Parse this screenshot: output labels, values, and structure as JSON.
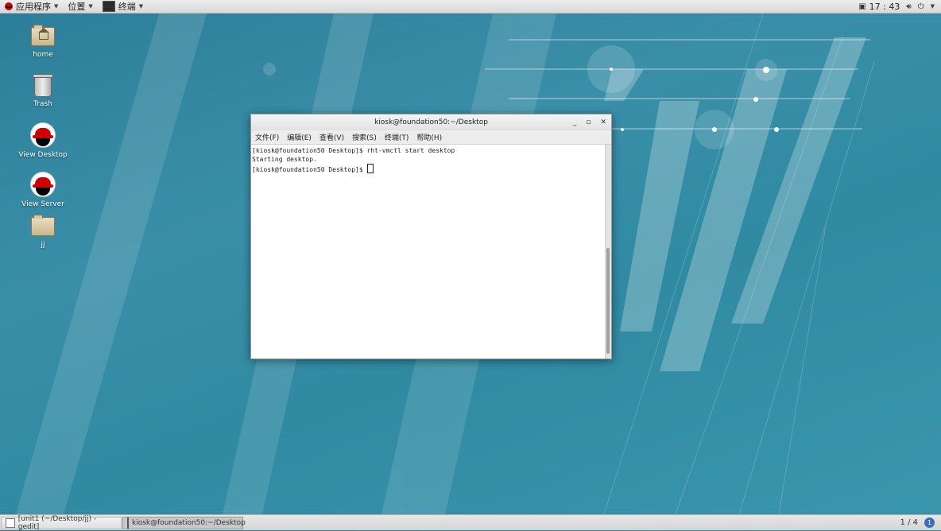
{
  "top_panel": {
    "applications_label": "应用程序",
    "places_label": "位置",
    "active_app_label": "终端",
    "clock": "17 : 43"
  },
  "desktop_icons": [
    {
      "label": "home"
    },
    {
      "label": "Trash"
    },
    {
      "label": "View Desktop"
    },
    {
      "label": "View Server"
    },
    {
      "label": "jj"
    }
  ],
  "terminal": {
    "title": "kiosk@foundation50:~/Desktop",
    "menu": [
      "文件(F)",
      "编辑(E)",
      "查看(V)",
      "搜索(S)",
      "终端(T)",
      "帮助(H)"
    ],
    "lines": [
      "[kiosk@foundation50 Desktop]$ rht-vmctl start desktop",
      "Starting desktop.",
      "[kiosk@foundation50 Desktop]$ "
    ]
  },
  "taskbar": {
    "tasks": [
      "[unit1 (~/Desktop/jj) - gedit]",
      "kiosk@foundation50:~/Desktop"
    ],
    "workspace": "1 / 4",
    "notification_count": "1"
  },
  "colors": {
    "wallpaper": "#2f86a0",
    "accent_red": "#cc0000"
  }
}
